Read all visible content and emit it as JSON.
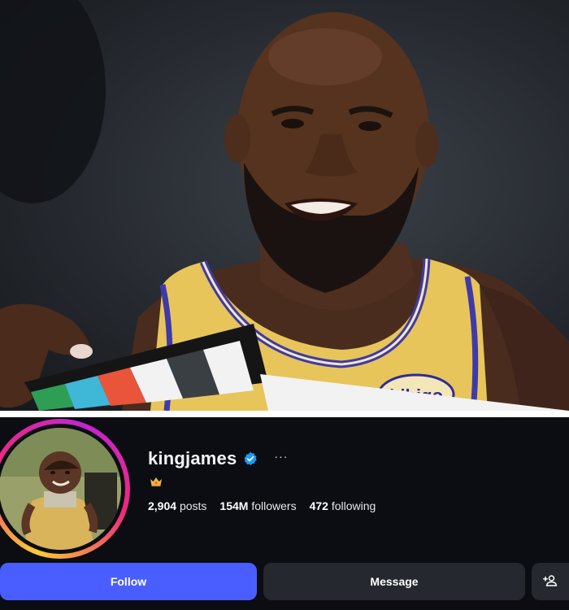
{
  "photo": {
    "description_icon": "clapperboard-icon",
    "jersey_sponsor": "bibigo"
  },
  "profile": {
    "username": "kingjames",
    "verified_icon": "verified-badge-icon",
    "more_label": "···",
    "bio_icon": "crown-icon",
    "stats": {
      "posts_count": "2,904",
      "posts_label": "posts",
      "followers_count": "154M",
      "followers_label": "followers",
      "following_count": "472",
      "following_label": "following"
    }
  },
  "actions": {
    "follow_label": "Follow",
    "message_label": "Message",
    "add_icon": "add-person-icon"
  },
  "colors": {
    "follow_button": "#4a5dff",
    "secondary_button": "#25282e",
    "verified": "#1d9bf0",
    "background": "#0b0d12"
  }
}
